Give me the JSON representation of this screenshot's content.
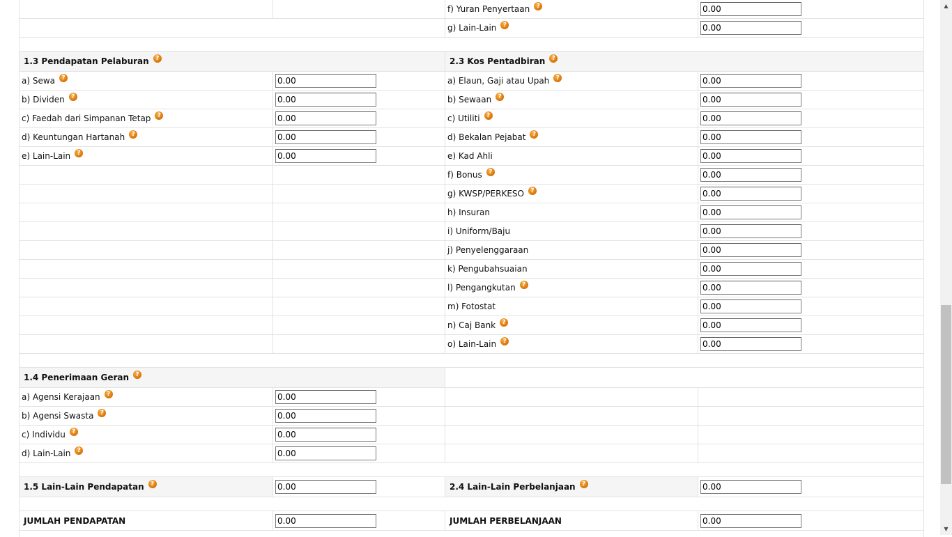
{
  "help_glyph": "?",
  "top_rows": {
    "f_label": "f) Yuran Penyertaan",
    "f_value": "0.00",
    "g_label": "g) Lain-Lain",
    "g_value": "0.00"
  },
  "pendapatan_pelaburan": {
    "title": "1.3 Pendapatan Pelaburan",
    "items": [
      {
        "label": "a) Sewa",
        "value": "0.00"
      },
      {
        "label": "b) Dividen",
        "value": "0.00"
      },
      {
        "label": "c) Faedah dari Simpanan Tetap",
        "value": "0.00"
      },
      {
        "label": "d) Keuntungan Hartanah",
        "value": "0.00"
      },
      {
        "label": "e) Lain-Lain",
        "value": "0.00"
      }
    ]
  },
  "kos_pentadbiran": {
    "title": "2.3 Kos Pentadbiran",
    "items": [
      {
        "label": "a) Elaun, Gaji atau Upah",
        "value": "0.00"
      },
      {
        "label": "b) Sewaan",
        "value": "0.00"
      },
      {
        "label": "c) Utiliti",
        "value": "0.00"
      },
      {
        "label": "d) Bekalan Pejabat",
        "value": "0.00"
      },
      {
        "label": "e) Kad Ahli",
        "value": "0.00"
      },
      {
        "label": "f) Bonus",
        "value": "0.00"
      },
      {
        "label": "g) KWSP/PERKESO",
        "value": "0.00"
      },
      {
        "label": "h) Insuran",
        "value": "0.00"
      },
      {
        "label": "i) Uniform/Baju",
        "value": "0.00"
      },
      {
        "label": "j) Penyelenggaraan",
        "value": "0.00"
      },
      {
        "label": "k) Pengubahsuaian",
        "value": "0.00"
      },
      {
        "label": "l) Pengangkutan",
        "value": "0.00"
      },
      {
        "label": "m) Fotostat",
        "value": "0.00"
      },
      {
        "label": "n) Caj Bank",
        "value": "0.00"
      },
      {
        "label": "o) Lain-Lain",
        "value": "0.00"
      }
    ]
  },
  "penerimaan_geran": {
    "title": "1.4 Penerimaan Geran",
    "items": [
      {
        "label": "a) Agensi Kerajaan",
        "value": "0.00"
      },
      {
        "label": "b) Agensi Swasta",
        "value": "0.00"
      },
      {
        "label": "c) Individu",
        "value": "0.00"
      },
      {
        "label": "d) Lain-Lain",
        "value": "0.00"
      }
    ]
  },
  "lain_pendapatan": {
    "title": "1.5 Lain-Lain Pendapatan",
    "value": "0.00"
  },
  "lain_perbelanjaan": {
    "title": "2.4 Lain-Lain Perbelanjaan",
    "value": "0.00"
  },
  "jumlah_pendapatan": {
    "title": "JUMLAH PENDAPATAN",
    "value": "0.00"
  },
  "jumlah_perbelanjaan": {
    "title": "JUMLAH PERBELANJAAN",
    "value": "0.00"
  },
  "scrollbar": {
    "up_glyph": "▲",
    "down_glyph": "▼"
  }
}
